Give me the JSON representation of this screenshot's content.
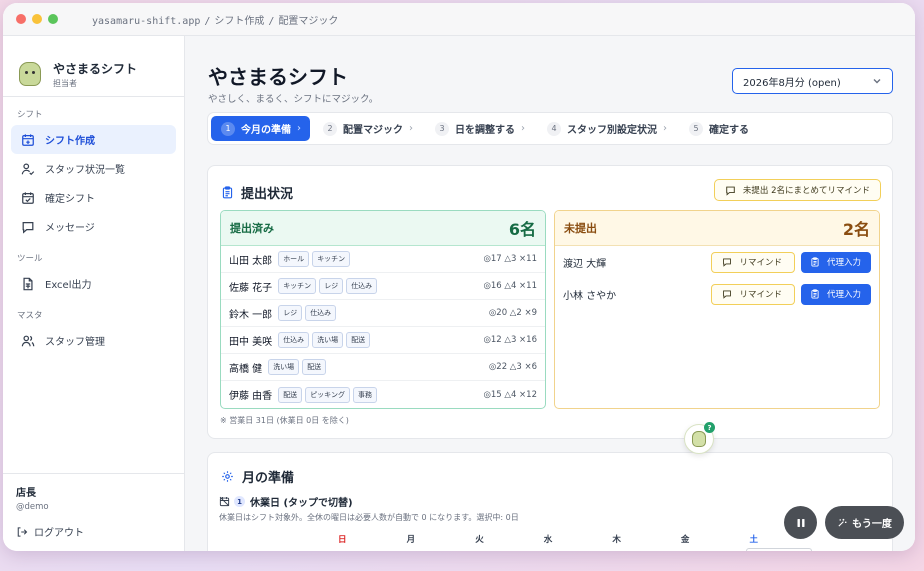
{
  "window": {
    "url_parts": [
      "yasamaru-shift.app",
      "シフト作成",
      "配置マジック"
    ]
  },
  "sidebar": {
    "brand_name": "やさまるシフト",
    "brand_role": "担当者",
    "groups": [
      {
        "label": "シフト",
        "items": [
          {
            "label": "シフト作成",
            "icon": "calendar-plus-icon",
            "active": true
          },
          {
            "label": "スタッフ状況一覧",
            "icon": "user-check-icon",
            "active": false
          },
          {
            "label": "確定シフト",
            "icon": "calendar-check-icon",
            "active": false
          },
          {
            "label": "メッセージ",
            "icon": "message-icon",
            "active": false
          }
        ]
      },
      {
        "label": "ツール",
        "items": [
          {
            "label": "Excel出力",
            "icon": "file-spreadsheet-icon",
            "active": false
          }
        ]
      },
      {
        "label": "マスタ",
        "items": [
          {
            "label": "スタッフ管理",
            "icon": "users-icon",
            "active": false
          }
        ]
      }
    ],
    "user_name": "店長",
    "user_id": "@demo",
    "logout_label": "ログアウト"
  },
  "header": {
    "title": "やさまるシフト",
    "subtitle": "やさしく、まるく、シフトにマジック。",
    "month_select": "2026年8月分 (open)"
  },
  "steps": [
    {
      "num": "1",
      "label": "今月の準備",
      "active": true
    },
    {
      "num": "2",
      "label": "配置マジック",
      "active": false
    },
    {
      "num": "3",
      "label": "日を調整する",
      "active": false
    },
    {
      "num": "4",
      "label": "スタッフ別設定状況",
      "active": false
    },
    {
      "num": "5",
      "label": "確定する",
      "active": false
    }
  ],
  "submission": {
    "title": "提出状況",
    "remind_all_label": "未提出 2名にまとめてリマインド",
    "submitted": {
      "label": "提出済み",
      "count": "6名",
      "rows": [
        {
          "name": "山田 太郎",
          "tags": [
            "ホール",
            "キッチン"
          ],
          "stat": "◎17 △3 ×11"
        },
        {
          "name": "佐藤 花子",
          "tags": [
            "キッチン",
            "レジ",
            "仕込み"
          ],
          "stat": "◎16 △4 ×11"
        },
        {
          "name": "鈴木 一郎",
          "tags": [
            "レジ",
            "仕込み"
          ],
          "stat": "◎20 △2 ×9"
        },
        {
          "name": "田中 美咲",
          "tags": [
            "仕込み",
            "洗い場",
            "配送"
          ],
          "stat": "◎12 △3 ×16"
        },
        {
          "name": "高橋 健",
          "tags": [
            "洗い場",
            "配送"
          ],
          "stat": "◎22 △3 ×6"
        },
        {
          "name": "伊藤 由香",
          "tags": [
            "配送",
            "ピッキング",
            "事務"
          ],
          "stat": "◎15 △4 ×12"
        }
      ]
    },
    "pending": {
      "label": "未提出",
      "count": "2名",
      "remind_label": "リマインド",
      "proxy_label": "代理入力",
      "rows": [
        {
          "name": "渡辺 大輝"
        },
        {
          "name": "小林 さやか"
        }
      ]
    },
    "footnote": "※ 営業日 31日 (休業日 0日 を除く)"
  },
  "prep": {
    "title": "月の準備",
    "holiday_num": "1",
    "holiday_title": "休業日 (タップで切替)",
    "holiday_help": "休業日はシフト対象外。全休の曜日は必要人数が自動で 0 になります。選択中: 0日",
    "weekdays": [
      "日",
      "月",
      "火",
      "水",
      "木",
      "金",
      "土"
    ]
  },
  "floating": {
    "help_badge": "?",
    "again_label": "もう一度"
  },
  "colors": {
    "accent": "#2563eb",
    "submitted_bg": "#ebf9f2",
    "pending_bg": "#fff8e6"
  }
}
